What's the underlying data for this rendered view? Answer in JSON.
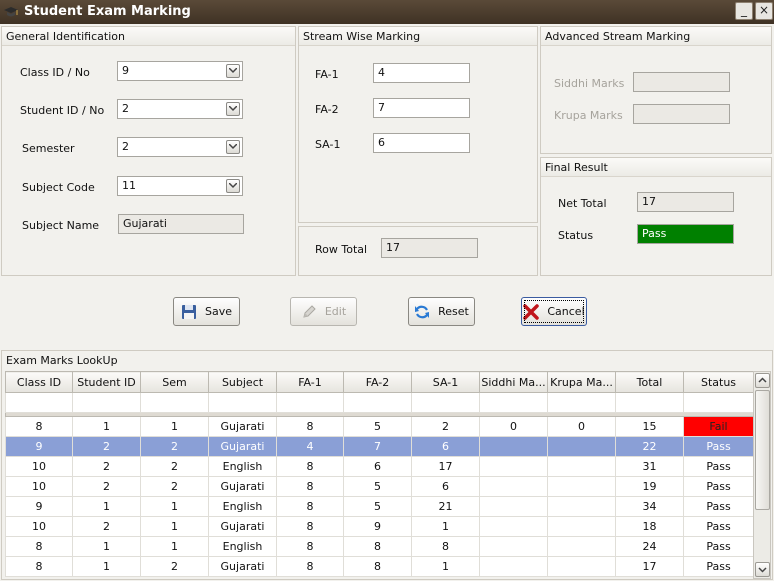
{
  "window": {
    "title": "Student Exam Marking",
    "minimize": "_",
    "close": "×"
  },
  "general": {
    "title": "General Identification",
    "class_label": "Class ID / No",
    "class_value": "9",
    "student_label": "Student ID / No",
    "student_value": "2",
    "semester_label": "Semester",
    "semester_value": "2",
    "subject_code_label": "Subject Code",
    "subject_code_value": "11",
    "subject_name_label": "Subject Name",
    "subject_name_value": "Gujarati"
  },
  "stream": {
    "title": "Stream Wise Marking",
    "fa1_label": "FA-1",
    "fa1_value": "4",
    "fa2_label": "FA-2",
    "fa2_value": "7",
    "sa1_label": "SA-1",
    "sa1_value": "6",
    "row_total_label": "Row Total",
    "row_total_value": "17"
  },
  "advanced": {
    "title": "Advanced Stream Marking",
    "siddhi_label": "Siddhi Marks",
    "krupa_label": "Krupa Marks"
  },
  "final": {
    "title": "Final Result",
    "net_total_label": "Net Total",
    "net_total_value": "17",
    "status_label": "Status",
    "status_value": "Pass",
    "status_color": "#008000"
  },
  "buttons": {
    "save": "Save",
    "edit": "Edit",
    "reset": "Reset",
    "cancel": "Cancel"
  },
  "lookup": {
    "title": "Exam Marks LookUp",
    "columns": [
      "Class ID",
      "Student ID",
      "Sem",
      "Subject",
      "FA-1",
      "FA-2",
      "SA-1",
      "Siddhi Ma...",
      "Krupa Ma...",
      "Total",
      "Status"
    ],
    "rows": [
      [
        "8",
        "1",
        "1",
        "Gujarati",
        "8",
        "5",
        "2",
        "0",
        "0",
        "15",
        "Fail"
      ],
      [
        "9",
        "2",
        "2",
        "Gujarati",
        "4",
        "7",
        "6",
        "",
        "",
        "22",
        "Pass"
      ],
      [
        "10",
        "2",
        "2",
        "English",
        "8",
        "6",
        "17",
        "",
        "",
        "31",
        "Pass"
      ],
      [
        "10",
        "2",
        "2",
        "Gujarati",
        "8",
        "5",
        "6",
        "",
        "",
        "19",
        "Pass"
      ],
      [
        "9",
        "1",
        "1",
        "English",
        "8",
        "5",
        "21",
        "",
        "",
        "34",
        "Pass"
      ],
      [
        "10",
        "2",
        "1",
        "Gujarati",
        "8",
        "9",
        "1",
        "",
        "",
        "18",
        "Pass"
      ],
      [
        "8",
        "1",
        "1",
        "English",
        "8",
        "8",
        "8",
        "",
        "",
        "24",
        "Pass"
      ],
      [
        "8",
        "1",
        "2",
        "Gujarati",
        "8",
        "8",
        "1",
        "",
        "",
        "17",
        "Pass"
      ]
    ],
    "selected_row": 1,
    "fail_color": "#ff0000",
    "selected_color": "#8a9fd6"
  }
}
